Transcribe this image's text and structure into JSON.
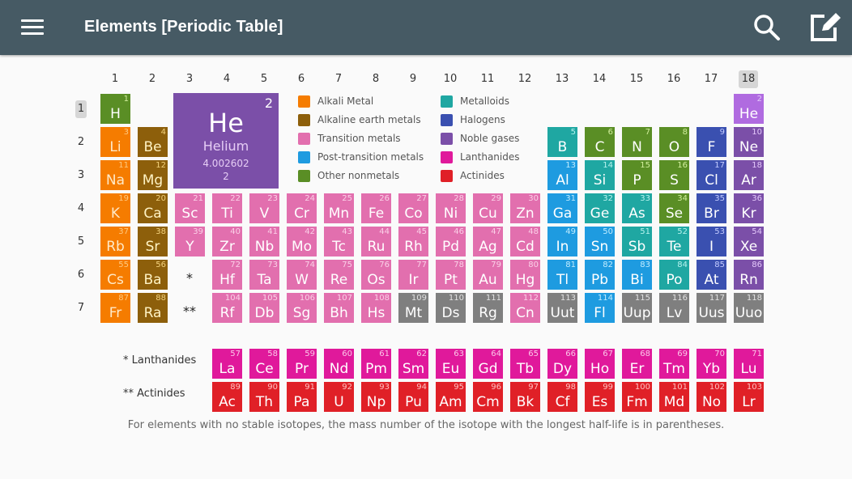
{
  "appbar": {
    "title": "Elements [Periodic Table]",
    "menu_icon": "hamburger-menu-icon",
    "search_icon": "search-icon",
    "edit_icon": "edit-icon"
  },
  "groups": [
    "1",
    "2",
    "3",
    "4",
    "5",
    "6",
    "7",
    "8",
    "9",
    "10",
    "11",
    "12",
    "13",
    "14",
    "15",
    "16",
    "17",
    "18"
  ],
  "highlighted_group": "18",
  "periods": [
    "1",
    "2",
    "3",
    "4",
    "5",
    "6",
    "7"
  ],
  "highlighted_period": "1",
  "selected_element": {
    "symbol": "He",
    "name": "Helium",
    "number": "2",
    "mass": "4.002602",
    "shells": "2",
    "color": "#7b4fa8"
  },
  "categories": {
    "alkali": {
      "label": "Alkali Metal",
      "color": "#f57c00",
      "numcolor": "#ffc981"
    },
    "alkaline": {
      "label": "Alkaline earth metals",
      "color": "#8d5f0b",
      "numcolor": "#f4d27d"
    },
    "transition": {
      "label": "Transition metals",
      "color": "#e26fae",
      "numcolor": "#fbd1e8"
    },
    "post": {
      "label": "Post-transition metals",
      "color": "#1e9be0",
      "numcolor": "#c0ecff"
    },
    "nonmetal": {
      "label": "Other nonmetals",
      "color": "#5a8e25",
      "numcolor": "#d3f09e"
    },
    "metalloid": {
      "label": "Metalloids",
      "color": "#1fa7a2",
      "numcolor": "#b7f3ef"
    },
    "halogen": {
      "label": "Halogens",
      "color": "#3a50b0",
      "numcolor": "#c3ccff"
    },
    "noble": {
      "label": "Noble gases",
      "color": "#7b4fa8",
      "numcolor": "#e4c8fb"
    },
    "lanthanide": {
      "label": "Lanthanides",
      "color": "#e0199b",
      "numcolor": "#fcc7e9"
    },
    "actinide": {
      "label": "Actinides",
      "color": "#e02027",
      "numcolor": "#ffc2c2"
    },
    "unknown": {
      "label": "",
      "color": "#7f7f7f",
      "numcolor": "#e3e3e3"
    }
  },
  "legend_left": [
    "alkali",
    "alkaline",
    "transition",
    "post",
    "nonmetal"
  ],
  "legend_right": [
    "metalloid",
    "halogen",
    "noble",
    "lanthanide",
    "actinide"
  ],
  "elements": [
    {
      "n": 1,
      "s": "H",
      "g": 1,
      "p": 1,
      "c": "nonmetal"
    },
    {
      "n": 2,
      "s": "He",
      "g": 18,
      "p": 1,
      "c": "noble",
      "hl": true
    },
    {
      "n": 3,
      "s": "Li",
      "g": 1,
      "p": 2,
      "c": "alkali"
    },
    {
      "n": 4,
      "s": "Be",
      "g": 2,
      "p": 2,
      "c": "alkaline"
    },
    {
      "n": 5,
      "s": "B",
      "g": 13,
      "p": 2,
      "c": "metalloid"
    },
    {
      "n": 6,
      "s": "C",
      "g": 14,
      "p": 2,
      "c": "nonmetal"
    },
    {
      "n": 7,
      "s": "N",
      "g": 15,
      "p": 2,
      "c": "nonmetal"
    },
    {
      "n": 8,
      "s": "O",
      "g": 16,
      "p": 2,
      "c": "nonmetal"
    },
    {
      "n": 9,
      "s": "F",
      "g": 17,
      "p": 2,
      "c": "halogen"
    },
    {
      "n": 10,
      "s": "Ne",
      "g": 18,
      "p": 2,
      "c": "noble"
    },
    {
      "n": 11,
      "s": "Na",
      "g": 1,
      "p": 3,
      "c": "alkali"
    },
    {
      "n": 12,
      "s": "Mg",
      "g": 2,
      "p": 3,
      "c": "alkaline"
    },
    {
      "n": 13,
      "s": "Al",
      "g": 13,
      "p": 3,
      "c": "post"
    },
    {
      "n": 14,
      "s": "Si",
      "g": 14,
      "p": 3,
      "c": "metalloid"
    },
    {
      "n": 15,
      "s": "P",
      "g": 15,
      "p": 3,
      "c": "nonmetal"
    },
    {
      "n": 16,
      "s": "S",
      "g": 16,
      "p": 3,
      "c": "nonmetal"
    },
    {
      "n": 17,
      "s": "Cl",
      "g": 17,
      "p": 3,
      "c": "halogen"
    },
    {
      "n": 18,
      "s": "Ar",
      "g": 18,
      "p": 3,
      "c": "noble"
    },
    {
      "n": 19,
      "s": "K",
      "g": 1,
      "p": 4,
      "c": "alkali"
    },
    {
      "n": 20,
      "s": "Ca",
      "g": 2,
      "p": 4,
      "c": "alkaline"
    },
    {
      "n": 21,
      "s": "Sc",
      "g": 3,
      "p": 4,
      "c": "transition"
    },
    {
      "n": 22,
      "s": "Ti",
      "g": 4,
      "p": 4,
      "c": "transition"
    },
    {
      "n": 23,
      "s": "V",
      "g": 5,
      "p": 4,
      "c": "transition"
    },
    {
      "n": 24,
      "s": "Cr",
      "g": 6,
      "p": 4,
      "c": "transition"
    },
    {
      "n": 25,
      "s": "Mn",
      "g": 7,
      "p": 4,
      "c": "transition"
    },
    {
      "n": 26,
      "s": "Fe",
      "g": 8,
      "p": 4,
      "c": "transition"
    },
    {
      "n": 27,
      "s": "Co",
      "g": 9,
      "p": 4,
      "c": "transition"
    },
    {
      "n": 28,
      "s": "Ni",
      "g": 10,
      "p": 4,
      "c": "transition"
    },
    {
      "n": 29,
      "s": "Cu",
      "g": 11,
      "p": 4,
      "c": "transition"
    },
    {
      "n": 30,
      "s": "Zn",
      "g": 12,
      "p": 4,
      "c": "transition"
    },
    {
      "n": 31,
      "s": "Ga",
      "g": 13,
      "p": 4,
      "c": "post"
    },
    {
      "n": 32,
      "s": "Ge",
      "g": 14,
      "p": 4,
      "c": "metalloid"
    },
    {
      "n": 33,
      "s": "As",
      "g": 15,
      "p": 4,
      "c": "metalloid"
    },
    {
      "n": 34,
      "s": "Se",
      "g": 16,
      "p": 4,
      "c": "nonmetal"
    },
    {
      "n": 35,
      "s": "Br",
      "g": 17,
      "p": 4,
      "c": "halogen"
    },
    {
      "n": 36,
      "s": "Kr",
      "g": 18,
      "p": 4,
      "c": "noble"
    },
    {
      "n": 37,
      "s": "Rb",
      "g": 1,
      "p": 5,
      "c": "alkali"
    },
    {
      "n": 38,
      "s": "Sr",
      "g": 2,
      "p": 5,
      "c": "alkaline"
    },
    {
      "n": 39,
      "s": "Y",
      "g": 3,
      "p": 5,
      "c": "transition"
    },
    {
      "n": 40,
      "s": "Zr",
      "g": 4,
      "p": 5,
      "c": "transition"
    },
    {
      "n": 41,
      "s": "Nb",
      "g": 5,
      "p": 5,
      "c": "transition"
    },
    {
      "n": 42,
      "s": "Mo",
      "g": 6,
      "p": 5,
      "c": "transition"
    },
    {
      "n": 43,
      "s": "Tc",
      "g": 7,
      "p": 5,
      "c": "transition"
    },
    {
      "n": 44,
      "s": "Ru",
      "g": 8,
      "p": 5,
      "c": "transition"
    },
    {
      "n": 45,
      "s": "Rh",
      "g": 9,
      "p": 5,
      "c": "transition"
    },
    {
      "n": 46,
      "s": "Pd",
      "g": 10,
      "p": 5,
      "c": "transition"
    },
    {
      "n": 47,
      "s": "Ag",
      "g": 11,
      "p": 5,
      "c": "transition"
    },
    {
      "n": 48,
      "s": "Cd",
      "g": 12,
      "p": 5,
      "c": "transition"
    },
    {
      "n": 49,
      "s": "In",
      "g": 13,
      "p": 5,
      "c": "post"
    },
    {
      "n": 50,
      "s": "Sn",
      "g": 14,
      "p": 5,
      "c": "post"
    },
    {
      "n": 51,
      "s": "Sb",
      "g": 15,
      "p": 5,
      "c": "metalloid"
    },
    {
      "n": 52,
      "s": "Te",
      "g": 16,
      "p": 5,
      "c": "metalloid"
    },
    {
      "n": 53,
      "s": "I",
      "g": 17,
      "p": 5,
      "c": "halogen"
    },
    {
      "n": 54,
      "s": "Xe",
      "g": 18,
      "p": 5,
      "c": "noble"
    },
    {
      "n": 55,
      "s": "Cs",
      "g": 1,
      "p": 6,
      "c": "alkali"
    },
    {
      "n": 56,
      "s": "Ba",
      "g": 2,
      "p": 6,
      "c": "alkaline"
    },
    {
      "n": 72,
      "s": "Hf",
      "g": 4,
      "p": 6,
      "c": "transition"
    },
    {
      "n": 73,
      "s": "Ta",
      "g": 5,
      "p": 6,
      "c": "transition"
    },
    {
      "n": 74,
      "s": "W",
      "g": 6,
      "p": 6,
      "c": "transition"
    },
    {
      "n": 75,
      "s": "Re",
      "g": 7,
      "p": 6,
      "c": "transition"
    },
    {
      "n": 76,
      "s": "Os",
      "g": 8,
      "p": 6,
      "c": "transition"
    },
    {
      "n": 77,
      "s": "Ir",
      "g": 9,
      "p": 6,
      "c": "transition"
    },
    {
      "n": 78,
      "s": "Pt",
      "g": 10,
      "p": 6,
      "c": "transition"
    },
    {
      "n": 79,
      "s": "Au",
      "g": 11,
      "p": 6,
      "c": "transition"
    },
    {
      "n": 80,
      "s": "Hg",
      "g": 12,
      "p": 6,
      "c": "transition"
    },
    {
      "n": 81,
      "s": "Tl",
      "g": 13,
      "p": 6,
      "c": "post"
    },
    {
      "n": 82,
      "s": "Pb",
      "g": 14,
      "p": 6,
      "c": "post"
    },
    {
      "n": 83,
      "s": "Bi",
      "g": 15,
      "p": 6,
      "c": "post"
    },
    {
      "n": 84,
      "s": "Po",
      "g": 16,
      "p": 6,
      "c": "metalloid"
    },
    {
      "n": 85,
      "s": "At",
      "g": 17,
      "p": 6,
      "c": "halogen"
    },
    {
      "n": 86,
      "s": "Rn",
      "g": 18,
      "p": 6,
      "c": "noble"
    },
    {
      "n": 87,
      "s": "Fr",
      "g": 1,
      "p": 7,
      "c": "alkali"
    },
    {
      "n": 88,
      "s": "Ra",
      "g": 2,
      "p": 7,
      "c": "alkaline"
    },
    {
      "n": 104,
      "s": "Rf",
      "g": 4,
      "p": 7,
      "c": "transition"
    },
    {
      "n": 105,
      "s": "Db",
      "g": 5,
      "p": 7,
      "c": "transition"
    },
    {
      "n": 106,
      "s": "Sg",
      "g": 6,
      "p": 7,
      "c": "transition"
    },
    {
      "n": 107,
      "s": "Bh",
      "g": 7,
      "p": 7,
      "c": "transition"
    },
    {
      "n": 108,
      "s": "Hs",
      "g": 8,
      "p": 7,
      "c": "transition"
    },
    {
      "n": 109,
      "s": "Mt",
      "g": 9,
      "p": 7,
      "c": "unknown"
    },
    {
      "n": 110,
      "s": "Ds",
      "g": 10,
      "p": 7,
      "c": "unknown"
    },
    {
      "n": 111,
      "s": "Rg",
      "g": 11,
      "p": 7,
      "c": "unknown"
    },
    {
      "n": 112,
      "s": "Cn",
      "g": 12,
      "p": 7,
      "c": "transition"
    },
    {
      "n": 113,
      "s": "Uut",
      "g": 13,
      "p": 7,
      "c": "unknown"
    },
    {
      "n": 114,
      "s": "Fl",
      "g": 14,
      "p": 7,
      "c": "post"
    },
    {
      "n": 115,
      "s": "Uup",
      "g": 15,
      "p": 7,
      "c": "unknown"
    },
    {
      "n": 116,
      "s": "Lv",
      "g": 16,
      "p": 7,
      "c": "unknown"
    },
    {
      "n": 117,
      "s": "Uus",
      "g": 17,
      "p": 7,
      "c": "unknown"
    },
    {
      "n": 118,
      "s": "Uuo",
      "g": 18,
      "p": 7,
      "c": "unknown"
    }
  ],
  "placeholders": {
    "period6": "*",
    "period7": "**"
  },
  "lanthanides": {
    "label": "* Lanthanides",
    "items": [
      {
        "n": 57,
        "s": "La"
      },
      {
        "n": 58,
        "s": "Ce"
      },
      {
        "n": 59,
        "s": "Pr"
      },
      {
        "n": 60,
        "s": "Nd"
      },
      {
        "n": 61,
        "s": "Pm"
      },
      {
        "n": 62,
        "s": "Sm"
      },
      {
        "n": 63,
        "s": "Eu"
      },
      {
        "n": 64,
        "s": "Gd"
      },
      {
        "n": 65,
        "s": "Tb"
      },
      {
        "n": 66,
        "s": "Dy"
      },
      {
        "n": 67,
        "s": "Ho"
      },
      {
        "n": 68,
        "s": "Er"
      },
      {
        "n": 69,
        "s": "Tm"
      },
      {
        "n": 70,
        "s": "Yb"
      },
      {
        "n": 71,
        "s": "Lu"
      }
    ]
  },
  "actinides": {
    "label": "** Actinides",
    "items": [
      {
        "n": 89,
        "s": "Ac"
      },
      {
        "n": 90,
        "s": "Th"
      },
      {
        "n": 91,
        "s": "Pa"
      },
      {
        "n": 92,
        "s": "U"
      },
      {
        "n": 93,
        "s": "Np"
      },
      {
        "n": 94,
        "s": "Pu"
      },
      {
        "n": 95,
        "s": "Am"
      },
      {
        "n": 96,
        "s": "Cm"
      },
      {
        "n": 97,
        "s": "Bk"
      },
      {
        "n": 98,
        "s": "Cf"
      },
      {
        "n": 99,
        "s": "Es"
      },
      {
        "n": 100,
        "s": "Fm"
      },
      {
        "n": 101,
        "s": "Md"
      },
      {
        "n": 102,
        "s": "No"
      },
      {
        "n": 103,
        "s": "Lr"
      }
    ]
  },
  "footnote": "For elements with no stable isotopes, the mass number of the isotope with the longest half-life is in parentheses."
}
